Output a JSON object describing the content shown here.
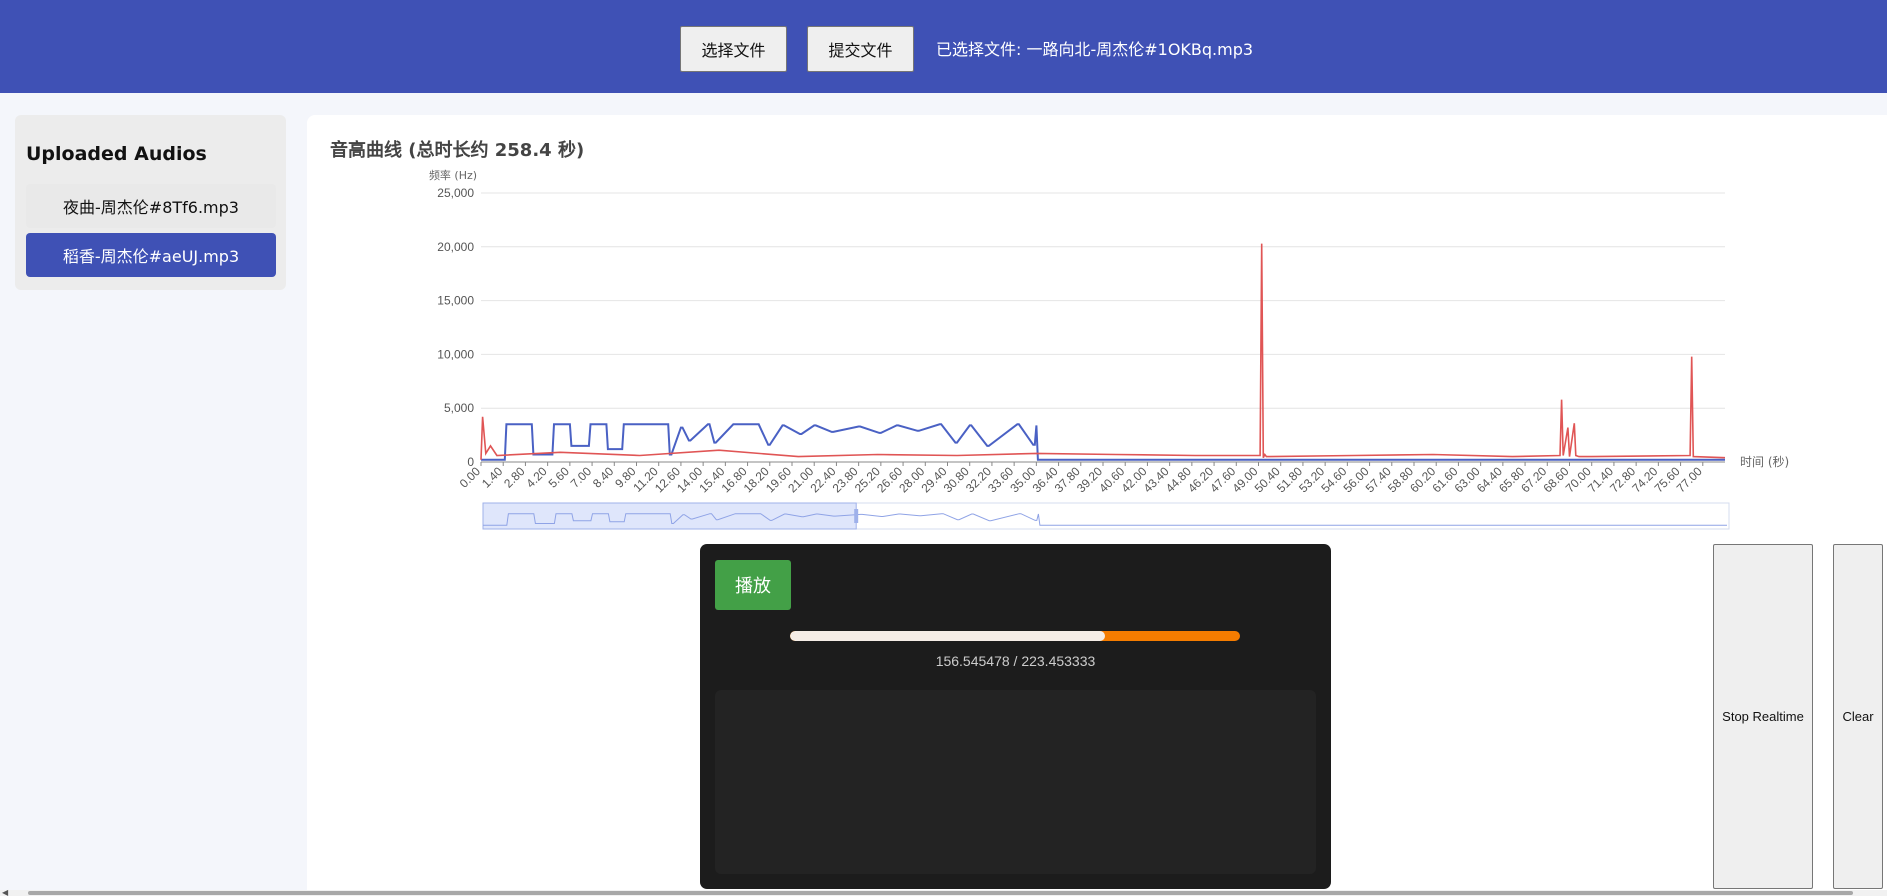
{
  "topbar": {
    "select_label": "选择文件",
    "submit_label": "提交文件",
    "selected_text": "已选择文件: 一路向北-周杰伦#1OKBq.mp3"
  },
  "sidebar": {
    "title": "Uploaded Audios",
    "items": [
      {
        "label": "夜曲-周杰伦#8Tf6.mp3",
        "selected": false
      },
      {
        "label": "稻香-周杰伦#aeUJ.mp3",
        "selected": true
      }
    ]
  },
  "chart_title": "音高曲线 (总时长约 258.4 秒)",
  "chart_data": {
    "type": "line",
    "ylabel": "频率 (Hz)",
    "xlabel": "时间 (秒)",
    "ylim": [
      0,
      25000
    ],
    "yticks": [
      "0",
      "5,000",
      "10,000",
      "15,000",
      "20,000",
      "25,000"
    ],
    "xticks": [
      "0.00",
      "1.40",
      "2.80",
      "4.20",
      "5.60",
      "7.00",
      "8.40",
      "9.80",
      "11.20",
      "12.60",
      "14.00",
      "15.40",
      "16.80",
      "18.20",
      "19.60",
      "21.00",
      "22.40",
      "23.80",
      "25.20",
      "26.60",
      "28.00",
      "29.40",
      "30.80",
      "32.20",
      "33.60",
      "35.00",
      "36.40",
      "37.80",
      "39.20",
      "40.60",
      "42.00",
      "43.40",
      "44.80",
      "46.20",
      "47.60",
      "49.00",
      "50.40",
      "51.80",
      "53.20",
      "54.60",
      "56.00",
      "57.40",
      "58.80",
      "60.20",
      "61.60",
      "63.00",
      "64.40",
      "65.80",
      "67.20",
      "68.60",
      "70.00",
      "71.40",
      "72.80",
      "74.20",
      "75.60",
      "77.00"
    ],
    "xlim": [
      0,
      78.4
    ],
    "grid": true,
    "series": [
      {
        "color": "#4a61c4",
        "x": [
          0,
          1.5,
          1.6,
          3.2,
          3.3,
          4.5,
          4.6,
          5.6,
          5.7,
          6.8,
          6.9,
          7.9,
          8.0,
          8.9,
          9.0,
          10.5,
          10.6,
          11.8,
          11.9,
          12.0,
          12.6,
          12.7,
          13.1,
          13.2,
          14.3,
          14.4,
          14.7,
          14.8,
          15.9,
          16.0,
          17.4,
          17.5,
          18.1,
          18.2,
          19.0,
          19.1,
          20.1,
          20.2,
          21.0,
          21.1,
          22.1,
          22.2,
          23.8,
          23.9,
          25.1,
          25.2,
          26.2,
          26.3,
          27.5,
          27.6,
          28.9,
          29.0,
          29.9,
          30.0,
          30.8,
          30.9,
          31.9,
          32.0,
          33.8,
          33.9,
          34.8,
          34.9,
          35.0,
          35.1,
          78.4
        ],
        "y": [
          200,
          200,
          3500,
          3500,
          700,
          700,
          3500,
          3500,
          1500,
          1500,
          3500,
          3500,
          1200,
          1200,
          3500,
          3500,
          3500,
          3500,
          700,
          700,
          3200,
          3200,
          2000,
          2000,
          3500,
          3500,
          1800,
          1800,
          3500,
          3500,
          3500,
          3500,
          1600,
          1600,
          3400,
          3400,
          2600,
          2600,
          3400,
          3400,
          2800,
          2800,
          3300,
          3300,
          2700,
          2700,
          3400,
          3400,
          2900,
          2900,
          3500,
          3500,
          1800,
          1800,
          3400,
          3400,
          1500,
          1500,
          3500,
          3500,
          1600,
          1600,
          3400,
          200,
          200
        ]
      },
      {
        "color": "#e05555",
        "x": [
          0,
          0.1,
          0.3,
          0.6,
          1.0,
          5.0,
          10.0,
          15.0,
          20.0,
          25.0,
          30.0,
          35.0,
          40.0,
          45.0,
          49.1,
          49.2,
          49.3,
          49.4,
          49.5,
          55.0,
          60.0,
          65.0,
          68.0,
          68.1,
          68.2,
          68.5,
          68.6,
          68.9,
          69.0,
          69.2,
          70.0,
          76.2,
          76.3,
          76.4,
          78.4
        ],
        "y": [
          200,
          4200,
          800,
          1500,
          600,
          900,
          600,
          1100,
          500,
          700,
          600,
          800,
          700,
          600,
          600,
          20300,
          400,
          700,
          500,
          600,
          700,
          500,
          600,
          5800,
          600,
          3200,
          500,
          3600,
          600,
          500,
          500,
          600,
          9800,
          500,
          400
        ]
      }
    ]
  },
  "player": {
    "play_label": "播放",
    "progress": 0.7006,
    "time_text": "156.545478 / 223.453333"
  },
  "buttons": {
    "stop_label": "Stop Realtime",
    "clear_label": "Clear"
  },
  "colors": {
    "primary": "#3f51b5",
    "play": "#43a047",
    "progress_track": "#f57c00",
    "pitch_line": "#4a61c4",
    "freq_line": "#e05555"
  }
}
